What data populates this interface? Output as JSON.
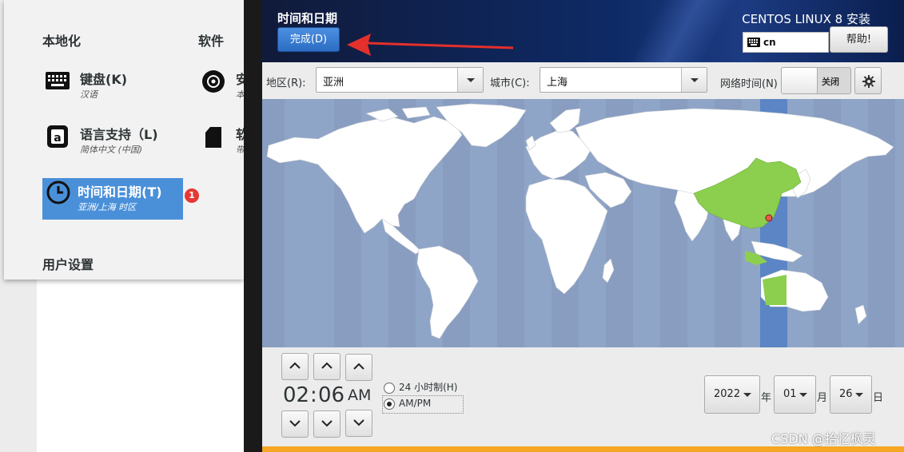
{
  "summary": {
    "localization_heading": "本地化",
    "software_heading": "软件",
    "user_heading": "用户设置",
    "spokes": [
      {
        "title": "键盘(K)",
        "subtitle": "汉语"
      },
      {
        "title": "语言支持（L)",
        "subtitle": "简体中文 (中国)"
      },
      {
        "title": "时间和日期(T)",
        "subtitle": "亚洲/上海 时区"
      },
      {
        "title": "安",
        "subtitle": "本"
      },
      {
        "title": "软",
        "subtitle": "带"
      }
    ],
    "badge": "1"
  },
  "header": {
    "title": "时间和日期",
    "done_label": "完成(D)",
    "product": "CENTOS LINUX 8 安装",
    "keyboard_layout": "cn",
    "help_label": "帮助!"
  },
  "toolbar": {
    "region_label": "地区(R):",
    "region_value": "亚洲",
    "city_label": "城市(C):",
    "city_value": "上海",
    "ntp_label": "网络时间(N)",
    "ntp_state": "关闭"
  },
  "time": {
    "hour": "02",
    "sep": ":",
    "minute": "06",
    "ampm": "AM",
    "format_24": "24 小时制(H)",
    "format_ampm": "AM/PM",
    "selected_format": "AM/PM"
  },
  "date": {
    "year": "2022",
    "year_unit": "年",
    "month": "01",
    "month_unit": "月",
    "day": "26",
    "day_unit": "日"
  },
  "watermark": "CSDN @拾忆枫灵",
  "colors": {
    "accent": "#4a90d9",
    "map_ocean": "#8fa5c7",
    "selected_zone": "#5b85c4",
    "selected_country": "#8ccf4e",
    "badge": "#e53935",
    "progress": "#f5a623"
  }
}
